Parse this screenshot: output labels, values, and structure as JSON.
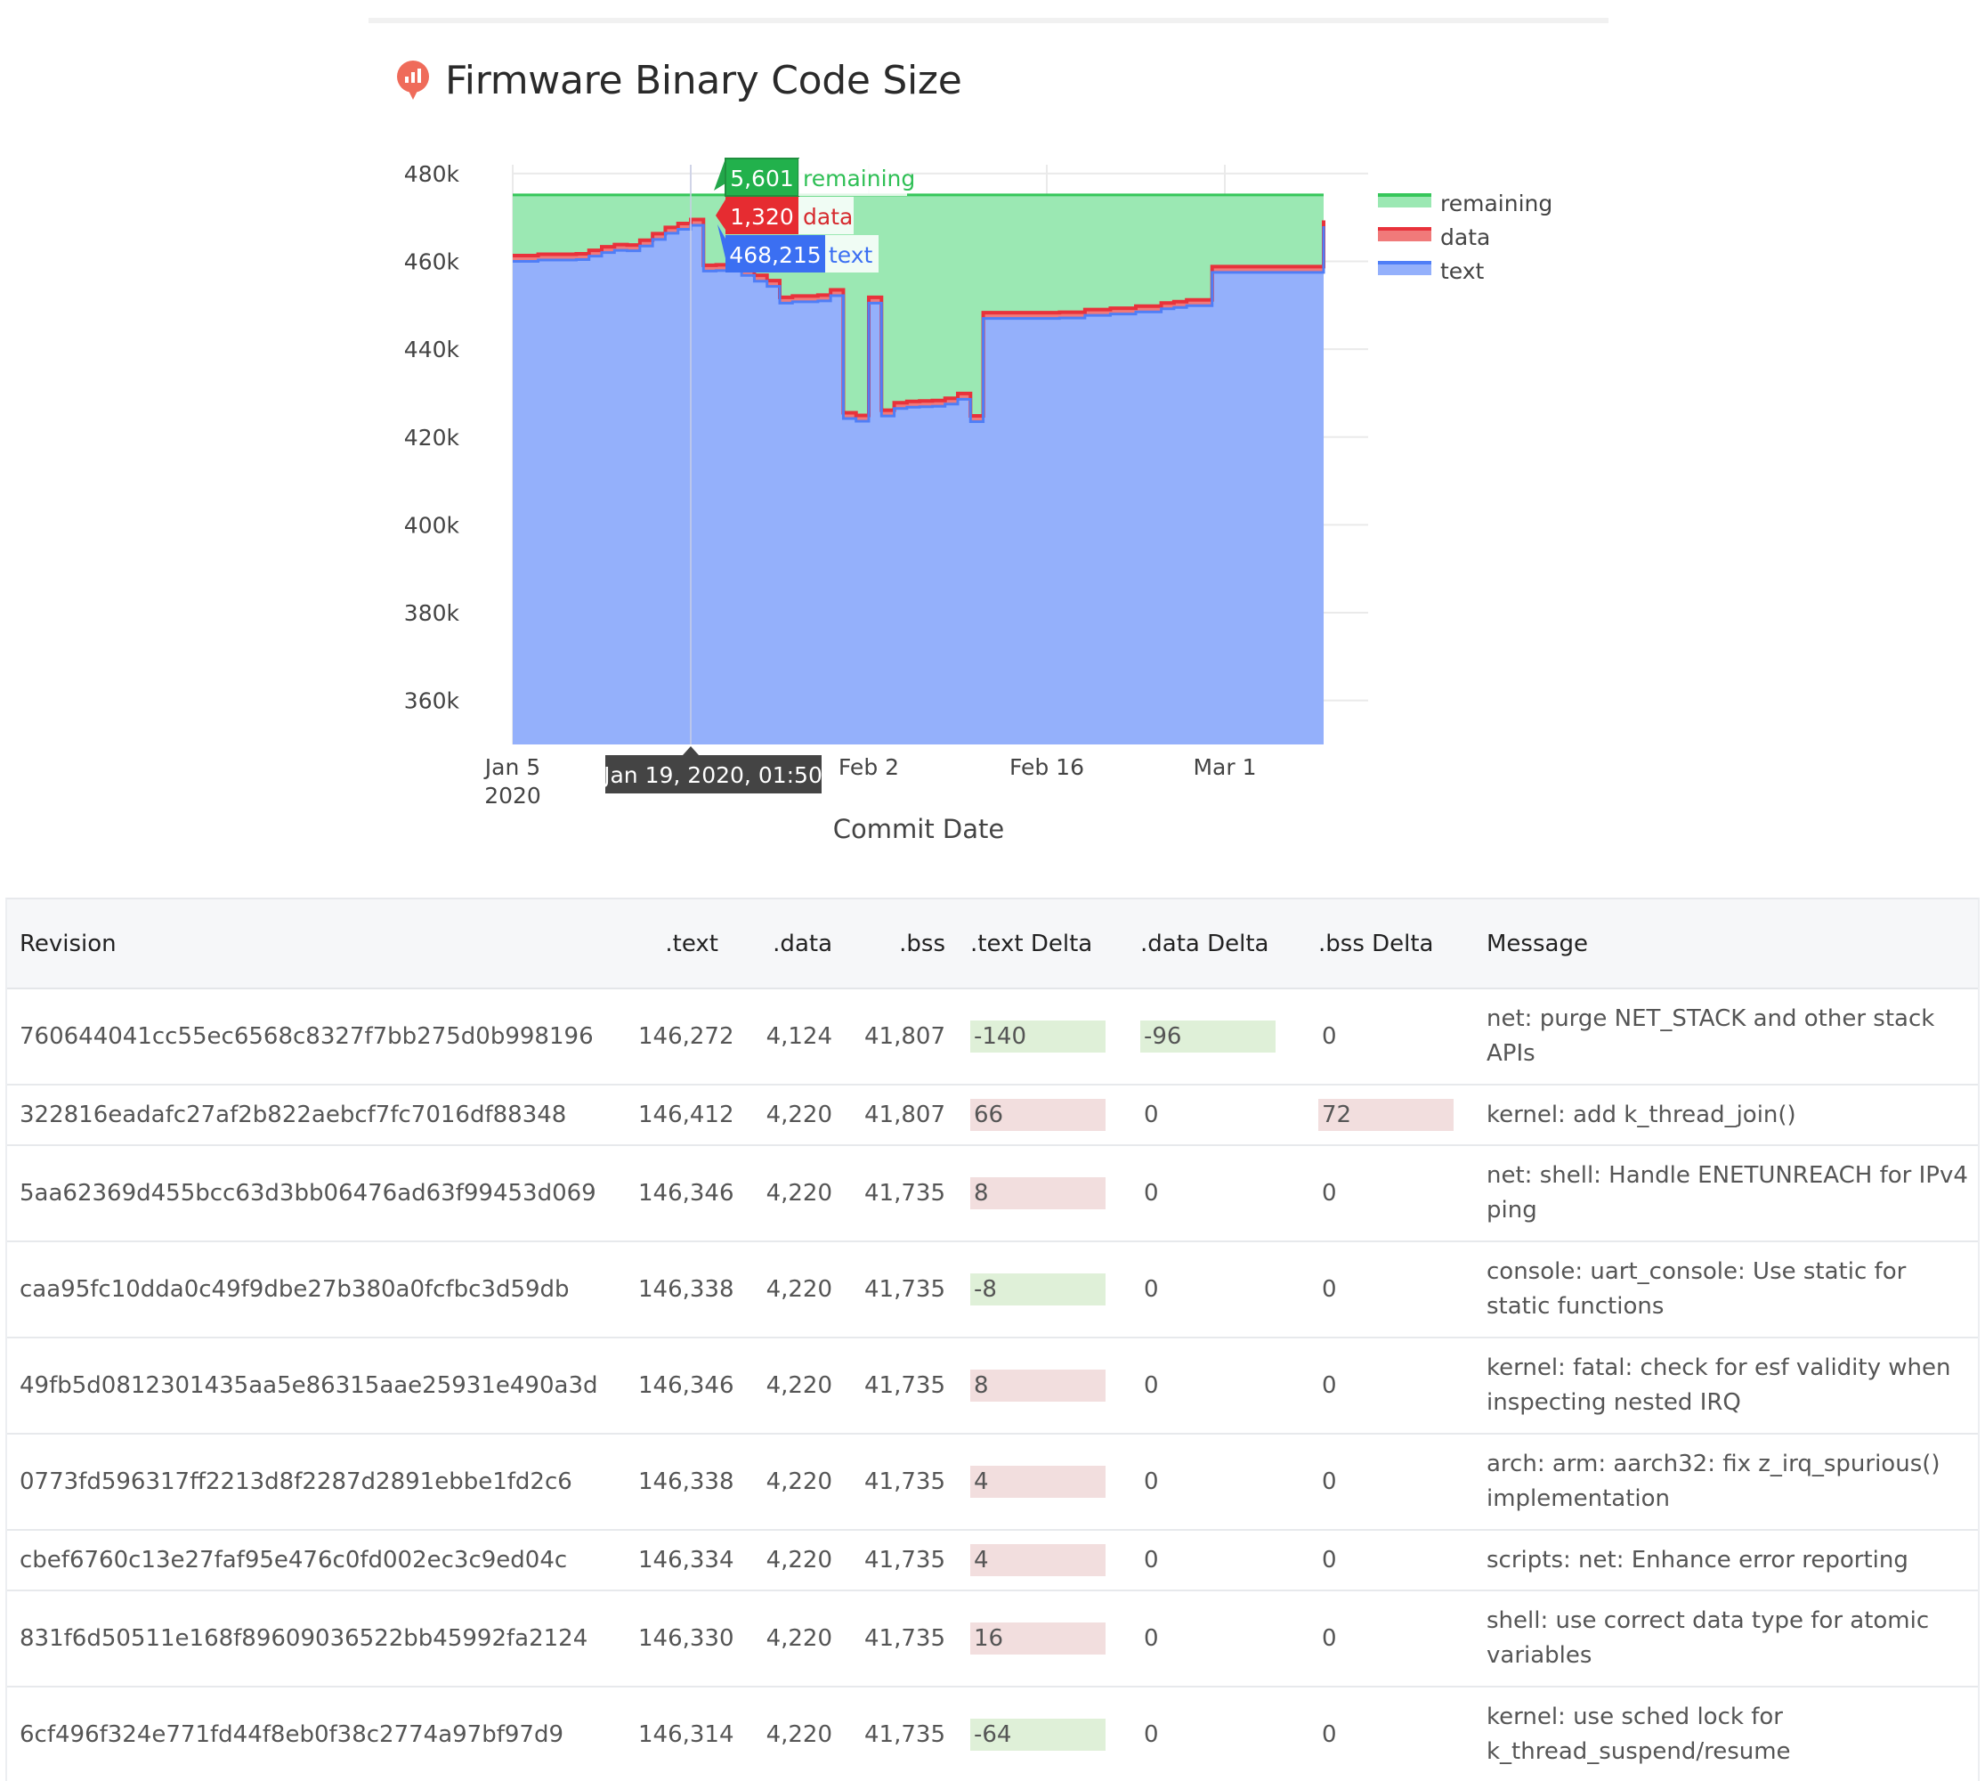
{
  "page": {
    "title": "Firmware Binary Code Size"
  },
  "chart_data": {
    "type": "area",
    "title": "",
    "xlabel": "Commit Date",
    "ylabel": "",
    "ylim": [
      350000,
      482000
    ],
    "y_ticks": [
      360000,
      380000,
      400000,
      420000,
      440000,
      460000,
      480000
    ],
    "y_tick_labels": [
      "360k",
      "380k",
      "400k",
      "420k",
      "440k",
      "460k",
      "480k"
    ],
    "x_ticks": [
      {
        "date": "2020-01-05",
        "label": "Jan 5",
        "sublabel": "2020"
      },
      {
        "date": "2020-01-19",
        "label": "Jan 19"
      },
      {
        "date": "2020-02-02",
        "label": "Feb 2"
      },
      {
        "date": "2020-02-16",
        "label": "Feb 16"
      },
      {
        "date": "2020-03-01",
        "label": "Mar 1"
      }
    ],
    "xlim": [
      "2020-01-05",
      "2020-03-02"
    ],
    "stacking": "stacked",
    "legend_position": "right",
    "grid": true,
    "capacity_total": 475136,
    "series": [
      {
        "name": "text",
        "color": "#4f7ef7",
        "fill": "#94b0fb"
      },
      {
        "name": "data",
        "color": "#e8323b",
        "fill": "#f07a7a"
      },
      {
        "name": "remaining",
        "color": "#36c65a",
        "fill": "#9be8b3"
      }
    ],
    "x": [
      "2020-01-05",
      "2020-01-07",
      "2020-01-08",
      "2020-01-09",
      "2020-01-10",
      "2020-01-11",
      "2020-01-12",
      "2020-01-13",
      "2020-01-14",
      "2020-01-15",
      "2020-01-16",
      "2020-01-17",
      "2020-01-18",
      "2020-01-19",
      "2020-01-20",
      "2020-01-21",
      "2020-01-22",
      "2020-01-23",
      "2020-01-24",
      "2020-01-25",
      "2020-01-26",
      "2020-01-27",
      "2020-01-28",
      "2020-01-29",
      "2020-01-30",
      "2020-01-31",
      "2020-02-01",
      "2020-02-02",
      "2020-02-03",
      "2020-02-04",
      "2020-02-05",
      "2020-02-06",
      "2020-02-07",
      "2020-02-08",
      "2020-02-09",
      "2020-02-10",
      "2020-02-11",
      "2020-02-12",
      "2020-02-14",
      "2020-02-17",
      "2020-02-19",
      "2020-02-21",
      "2020-02-23",
      "2020-02-25",
      "2020-02-26",
      "2020-02-27",
      "2020-02-28",
      "2020-02-29",
      "2020-03-01"
    ],
    "text": [
      460000,
      460300,
      460300,
      460300,
      460400,
      461200,
      462000,
      462500,
      462400,
      463500,
      465000,
      466400,
      467300,
      468215,
      457800,
      457900,
      457800,
      456800,
      455500,
      454300,
      450500,
      450800,
      450800,
      451000,
      452200,
      424200,
      423600,
      450500,
      424800,
      426500,
      426800,
      426900,
      427000,
      427500,
      428600,
      423500,
      447000,
      447000,
      447000,
      447100,
      447700,
      448000,
      448500,
      449200,
      449500,
      449900,
      449900,
      457500,
      468000
    ],
    "data": [
      1320,
      1320,
      1320,
      1320,
      1320,
      1320,
      1320,
      1320,
      1320,
      1320,
      1320,
      1320,
      1320,
      1320,
      1320,
      1320,
      1320,
      1320,
      1320,
      1320,
      1320,
      1320,
      1320,
      1320,
      1320,
      1320,
      1320,
      1320,
      1320,
      1320,
      1320,
      1320,
      1320,
      1320,
      1320,
      1320,
      1320,
      1320,
      1320,
      1320,
      1320,
      1320,
      1320,
      1320,
      1320,
      1320,
      1320,
      1320,
      1320
    ]
  },
  "hover": {
    "date_label": "Jan 19, 2020, 01:50",
    "remaining_value": "5,601",
    "remaining_name": "remaining",
    "data_value": "1,320",
    "data_name": "data",
    "text_value": "468,215",
    "text_name": "text"
  },
  "legend": {
    "items": [
      "remaining",
      "data",
      "text"
    ]
  },
  "table": {
    "headers": [
      "Revision",
      ".text",
      ".data",
      ".bss",
      ".text Delta",
      ".data Delta",
      ".bss Delta",
      "Message"
    ],
    "rows": [
      {
        "revision": "760644041cc55ec6568c8327f7bb275d0b998196",
        "text": "146,272",
        "data": "4,124",
        "bss": "41,807",
        "text_delta": "-140",
        "data_delta": "-96",
        "bss_delta": "0",
        "message": "net: purge NET_STACK and other stack APIs"
      },
      {
        "revision": "322816eadafc27af2b822aebcf7fc7016df88348",
        "text": "146,412",
        "data": "4,220",
        "bss": "41,807",
        "text_delta": "66",
        "data_delta": "0",
        "bss_delta": "72",
        "message": "kernel: add k_thread_join()"
      },
      {
        "revision": "5aa62369d455bcc63d3bb06476ad63f99453d069",
        "text": "146,346",
        "data": "4,220",
        "bss": "41,735",
        "text_delta": "8",
        "data_delta": "0",
        "bss_delta": "0",
        "message": "net: shell: Handle ENETUNREACH for IPv4 ping"
      },
      {
        "revision": "caa95fc10dda0c49f9dbe27b380a0fcfbc3d59db",
        "text": "146,338",
        "data": "4,220",
        "bss": "41,735",
        "text_delta": "-8",
        "data_delta": "0",
        "bss_delta": "0",
        "message": "console: uart_console: Use static for static functions"
      },
      {
        "revision": "49fb5d0812301435aa5e86315aae25931e490a3d",
        "text": "146,346",
        "data": "4,220",
        "bss": "41,735",
        "text_delta": "8",
        "data_delta": "0",
        "bss_delta": "0",
        "message": "kernel: fatal: check for esf validity when inspecting nested IRQ"
      },
      {
        "revision": "0773fd596317ff2213d8f2287d2891ebbe1fd2c6",
        "text": "146,338",
        "data": "4,220",
        "bss": "41,735",
        "text_delta": "4",
        "data_delta": "0",
        "bss_delta": "0",
        "message": "arch: arm: aarch32: fix z_irq_spurious() implementation"
      },
      {
        "revision": "cbef6760c13e27faf95e476c0fd002ec3c9ed04c",
        "text": "146,334",
        "data": "4,220",
        "bss": "41,735",
        "text_delta": "4",
        "data_delta": "0",
        "bss_delta": "0",
        "message": "scripts: net: Enhance error reporting"
      },
      {
        "revision": "831f6d50511e168f89609036522bb45992fa2124",
        "text": "146,330",
        "data": "4,220",
        "bss": "41,735",
        "text_delta": "16",
        "data_delta": "0",
        "bss_delta": "0",
        "message": "shell: use correct data type for atomic variables"
      },
      {
        "revision": "6cf496f324e771fd44f8eb0f38c2774a97bf97d9",
        "text": "146,314",
        "data": "4,220",
        "bss": "41,735",
        "text_delta": "-64",
        "data_delta": "0",
        "bss_delta": "0",
        "message": "kernel: use sched lock for k_thread_suspend/resume"
      }
    ]
  }
}
